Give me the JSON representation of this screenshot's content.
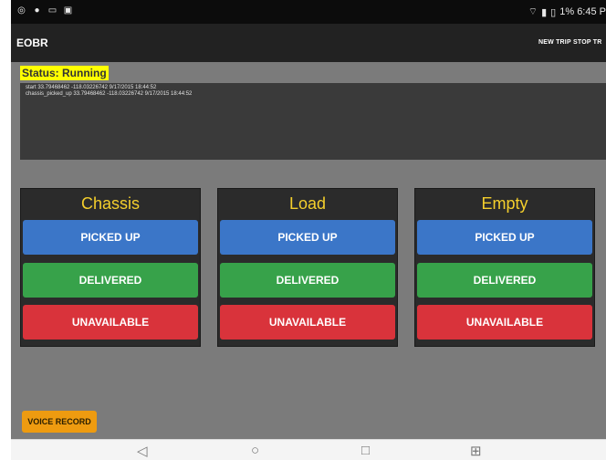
{
  "status_bar": {
    "left_icons": [
      "circle-icon",
      "location-pin-icon",
      "message-icon",
      "image-icon"
    ],
    "right_text": "1% 6:45 P"
  },
  "app_bar": {
    "title": "EOBR",
    "actions": [
      "NEW TRIP",
      "STOP TR"
    ]
  },
  "status": {
    "label": "Status: Running",
    "log_lines": [
      "start 33.79468462 -118.03226742 9/17/2015 18:44:52",
      "chassis_picked_up 33.79468462 -118.03226742 9/17/2015 18:44:52"
    ]
  },
  "panels": [
    {
      "title": "Chassis",
      "buttons": [
        "PICKED UP",
        "DELIVERED",
        "UNAVAILABLE"
      ]
    },
    {
      "title": "Load",
      "buttons": [
        "PICKED UP",
        "DELIVERED",
        "UNAVAILABLE"
      ]
    },
    {
      "title": "Empty",
      "buttons": [
        "PICKED UP",
        "DELIVERED",
        "UNAVAILABLE"
      ]
    }
  ],
  "voice_button": "VOICE RECORD",
  "navigation": {
    "icons": [
      "back-icon",
      "home-icon",
      "recents-icon",
      "screenshot-icon"
    ]
  },
  "colors": {
    "status_highlight": "#ffff00",
    "panel_title": "#f4cf2c",
    "picked_up": "#3b76c8",
    "delivered": "#37a24a",
    "unavailable": "#d9333b",
    "voice_record": "#ee9b10"
  }
}
